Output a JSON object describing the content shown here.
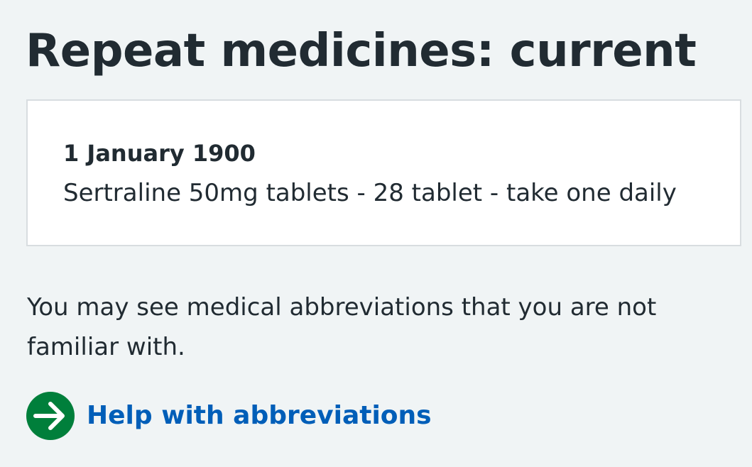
{
  "page": {
    "title": "Repeat medicines: current"
  },
  "medicine": {
    "date": "1 January 1900",
    "detail": "Sertraline 50mg tablets - 28 tablet - take one daily"
  },
  "info": {
    "text": "You may see medical abbreviations that you are not familiar with."
  },
  "help_link": {
    "label": "Help with abbreviations",
    "icon": "arrow-right-circle-icon"
  },
  "colors": {
    "background": "#f0f4f5",
    "text": "#212b32",
    "link": "#005eb8",
    "icon_circle": "#007f3b",
    "card_border": "#d8dde0",
    "card_background": "#ffffff"
  }
}
